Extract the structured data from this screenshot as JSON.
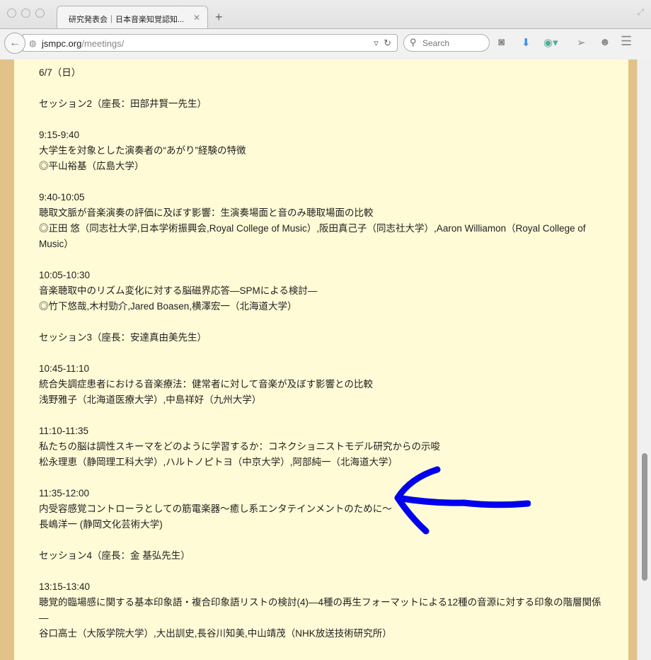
{
  "browser": {
    "tab_title": "研究発表会｜日本音楽知覚認知...",
    "url_host": "jsmpc.org",
    "url_path": "/meetings/",
    "search_placeholder": "Search"
  },
  "page": {
    "date": "6/7（日）",
    "session2": "セッション2（座長：田部井賢一先生）",
    "talks2": [
      {
        "time": "9:15-9:40",
        "title": "大学生を対象とした演奏者の“あがり”経験の特徴",
        "authors": "◎平山裕基（広島大学）"
      },
      {
        "time": "9:40-10:05",
        "title": "聴取文脈が音楽演奏の評価に及ぼす影響：生演奏場面と音のみ聴取場面の比較",
        "authors": "◎正田 悠（同志社大学,日本学術振興会,Royal College of Music）,阪田真己子（同志社大学）,Aaron Williamon（Royal College of Music）"
      },
      {
        "time": "10:05-10:30",
        "title": "音楽聴取中のリズム変化に対する脳磁界応答—SPMによる検討—",
        "authors": "◎竹下悠哉,木村勁介,Jared Boasen,横澤宏一（北海道大学）"
      }
    ],
    "session3": "セッション3（座長：安達真由美先生）",
    "talks3": [
      {
        "time": "10:45-11:10",
        "title": "統合失調症患者における音楽療法：健常者に対して音楽が及ぼす影響との比較",
        "authors": "浅野雅子（北海道医療大学）,中島祥好（九州大学）"
      },
      {
        "time": "11:10-11:35",
        "title": "私たちの脳は調性スキーマをどのように学習するか：コネクショニストモデル研究からの示唆",
        "authors": "松永理恵（静岡理工科大学）,ハルトノピトヨ（中京大学）,阿部純一（北海道大学）"
      },
      {
        "time": "11:35-12:00",
        "title": "内受容感覚コントローラとしての筋電楽器〜癒し系エンタテインメントのために〜",
        "authors": "長嶋洋一 (静岡文化芸術大学)"
      }
    ],
    "session4": "セッション4（座長：金 基弘先生）",
    "talks4": [
      {
        "time": "13:15-13:40",
        "title": "聴覚的臨場感に関する基本印象語・複合印象語リストの検討(4)—4種の再生フォーマットによる12種の音源に対する印象の階層関係—",
        "authors": "谷口高士（大阪学院大学）,大出訓史,長谷川知美,中山靖茂（NHK放送技術研究所）"
      }
    ]
  },
  "colors": {
    "page_bg": "#fffbd6",
    "outer_bg": "#e2c289",
    "annotation_arrow": "#0000ee"
  }
}
